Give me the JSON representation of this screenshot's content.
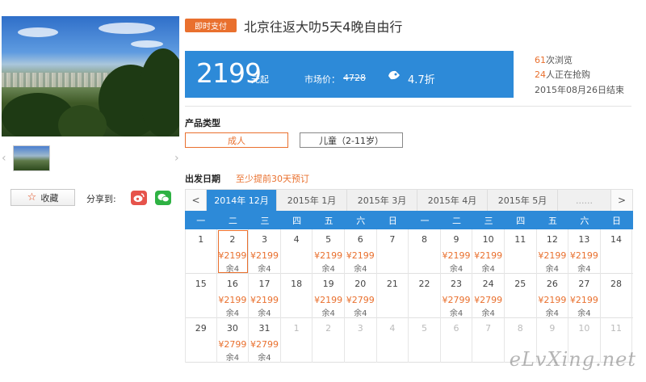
{
  "gallery": {
    "prev_icon": "‹",
    "next_icon": "›"
  },
  "actions": {
    "favorite_label": "收藏",
    "share_label": "分享到:"
  },
  "product": {
    "badge": "即时支付",
    "title": "北京往返大叻5天4晚自由行",
    "price": "2199",
    "price_suffix": "元起",
    "market_label": "市场价：",
    "market_price": "4728",
    "discount": "4.7折",
    "views_count": "61",
    "views_text": "次浏览",
    "buying_count": "24",
    "buying_text": "人正在抢购",
    "end_text": "2015年08月26日结束"
  },
  "product_type": {
    "title": "产品类型",
    "options": [
      "成人",
      "儿童（2-11岁）"
    ]
  },
  "departure": {
    "title": "出发日期",
    "note": "至少提前30天预订",
    "tabs": [
      "2014年 12月",
      "2015年 1月",
      "2015年 3月",
      "2015年 4月",
      "2015年 5月",
      "......"
    ],
    "nav_prev": "<",
    "nav_next": ">",
    "weekdays": [
      "一",
      "二",
      "三",
      "四",
      "五",
      "六",
      "日",
      "一",
      "二",
      "三",
      "四",
      "五",
      "六",
      "日"
    ],
    "weeks": [
      [
        {
          "day": "1",
          "price": "",
          "left": ""
        },
        {
          "day": "2",
          "price": "¥2199",
          "left": "余4",
          "selected": true
        },
        {
          "day": "3",
          "price": "¥2199",
          "left": "余4"
        },
        {
          "day": "4",
          "price": "",
          "left": ""
        },
        {
          "day": "5",
          "price": "¥2199",
          "left": "余4"
        },
        {
          "day": "6",
          "price": "¥2199",
          "left": "余4"
        },
        {
          "day": "7",
          "price": "",
          "left": ""
        },
        {
          "day": "8",
          "price": "",
          "left": ""
        },
        {
          "day": "9",
          "price": "¥2199",
          "left": "余4"
        },
        {
          "day": "10",
          "price": "¥2199",
          "left": "余4"
        },
        {
          "day": "11",
          "price": "",
          "left": ""
        },
        {
          "day": "12",
          "price": "¥2199",
          "left": "余4"
        },
        {
          "day": "13",
          "price": "¥2199",
          "left": "余4"
        },
        {
          "day": "14",
          "price": "",
          "left": ""
        }
      ],
      [
        {
          "day": "15",
          "price": "",
          "left": ""
        },
        {
          "day": "16",
          "price": "¥2199",
          "left": "余4"
        },
        {
          "day": "17",
          "price": "¥2199",
          "left": "余4"
        },
        {
          "day": "18",
          "price": "",
          "left": ""
        },
        {
          "day": "19",
          "price": "¥2199",
          "left": "余4"
        },
        {
          "day": "20",
          "price": "¥2799",
          "left": "余4"
        },
        {
          "day": "21",
          "price": "",
          "left": ""
        },
        {
          "day": "22",
          "price": "",
          "left": ""
        },
        {
          "day": "23",
          "price": "¥2799",
          "left": "余4"
        },
        {
          "day": "24",
          "price": "¥2799",
          "left": "余4"
        },
        {
          "day": "25",
          "price": "",
          "left": ""
        },
        {
          "day": "26",
          "price": "¥2199",
          "left": "余4"
        },
        {
          "day": "27",
          "price": "¥2199",
          "left": "余4"
        },
        {
          "day": "28",
          "price": "",
          "left": ""
        }
      ],
      [
        {
          "day": "29",
          "price": "",
          "left": ""
        },
        {
          "day": "30",
          "price": "¥2799",
          "left": "余4"
        },
        {
          "day": "31",
          "price": "¥2799",
          "left": "余4"
        },
        {
          "day": "1",
          "price": "",
          "left": "",
          "dim": true
        },
        {
          "day": "2",
          "price": "",
          "left": "",
          "dim": true
        },
        {
          "day": "3",
          "price": "",
          "left": "",
          "dim": true
        },
        {
          "day": "4",
          "price": "",
          "left": "",
          "dim": true
        },
        {
          "day": "5",
          "price": "",
          "left": "",
          "dim": true
        },
        {
          "day": "6",
          "price": "",
          "left": "",
          "dim": true
        },
        {
          "day": "7",
          "price": "",
          "left": "",
          "dim": true
        },
        {
          "day": "8",
          "price": "",
          "left": "",
          "dim": true
        },
        {
          "day": "9",
          "price": "",
          "left": "",
          "dim": true
        },
        {
          "day": "10",
          "price": "",
          "left": "",
          "dim": true
        },
        {
          "day": "11",
          "price": "",
          "left": "",
          "dim": true
        }
      ]
    ]
  },
  "watermark": "eLvXing.net",
  "colors": {
    "accent": "#2d8ad8",
    "highlight": "#e9702e"
  }
}
